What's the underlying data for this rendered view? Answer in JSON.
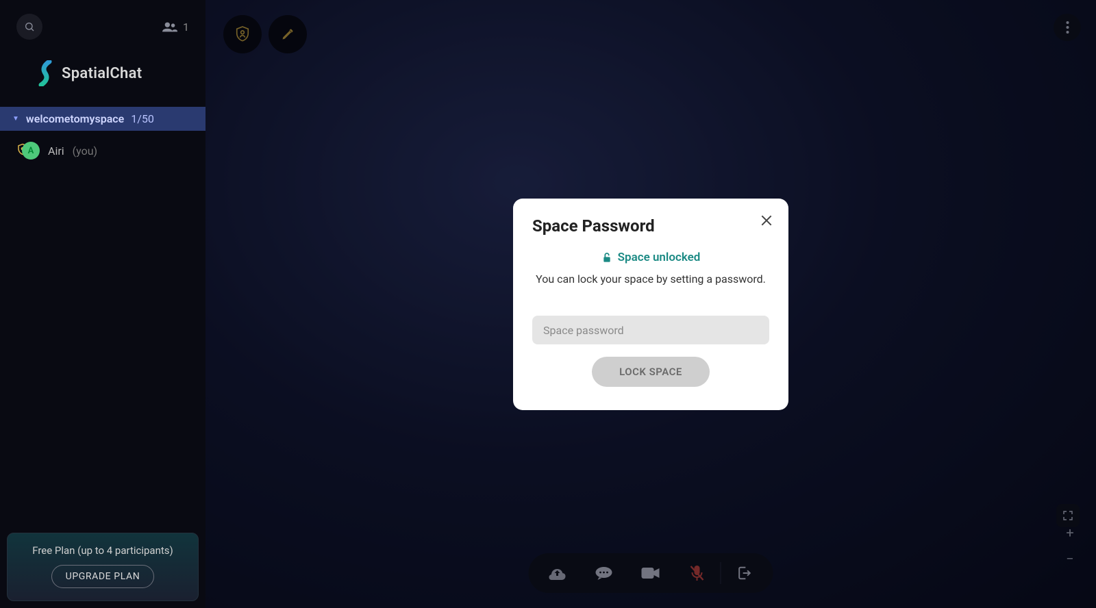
{
  "app": {
    "logo_text": "SpatialChat"
  },
  "sidebar": {
    "participants_count": "1",
    "channel": {
      "name": "welcometomyspace",
      "count": "1/50"
    },
    "user": {
      "name": "Airi",
      "you_suffix": "(you)",
      "initial": "A"
    },
    "plan": {
      "line": "Free Plan (up to 4 participants)",
      "cta": "UPGRADE PLAN"
    }
  },
  "modal": {
    "title": "Space Password",
    "status": "Space unlocked",
    "description": "You can lock your space by setting a password.",
    "placeholder": "Space password",
    "button": "LOCK SPACE"
  }
}
